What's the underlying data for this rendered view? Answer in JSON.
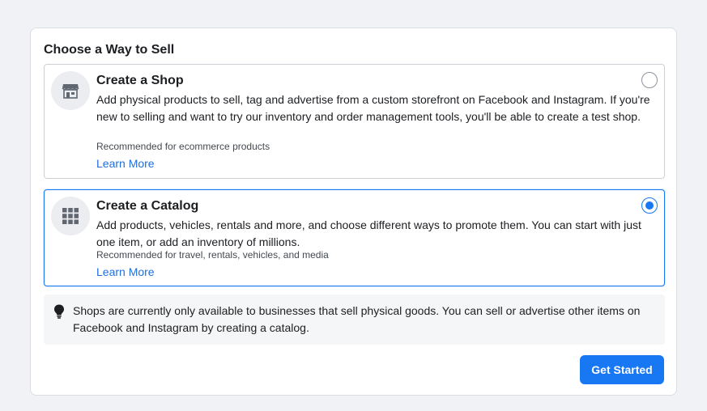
{
  "card": {
    "title": "Choose a Way to Sell"
  },
  "options": [
    {
      "title": "Create a Shop",
      "description": "Add physical products to sell, tag and advertise from a custom storefront on Facebook and Instagram. If you're new to selling and want to try our inventory and order management tools, you'll be able to create a test shop.",
      "recommendation": "Recommended for ecommerce products",
      "link": "Learn More",
      "icon": "storefront-icon",
      "selected": false
    },
    {
      "title": "Create a Catalog",
      "description": "Add products, vehicles, rentals and more, and choose different ways to promote them. You can start with just one item, or add an inventory of millions.",
      "recommendation": "Recommended for travel, rentals, vehicles, and media",
      "link": "Learn More",
      "icon": "grid-icon",
      "selected": true
    }
  ],
  "notice": {
    "icon": "lightbulb-icon",
    "text": "Shops are currently only available to businesses that sell physical goods. You can sell or advertise other items on Facebook and Instagram by creating a catalog."
  },
  "actions": {
    "get_started_label": "Get Started"
  },
  "colors": {
    "accent": "#1877f2",
    "link": "#216fdb",
    "background": "#f0f2f5"
  }
}
